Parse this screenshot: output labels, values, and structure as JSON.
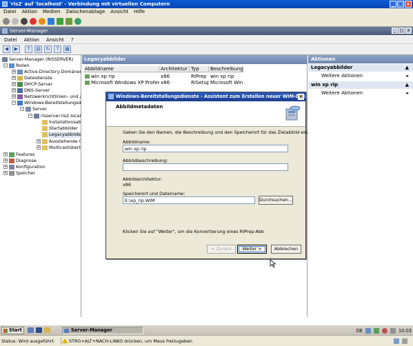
{
  "vm_window": {
    "title": "'ris2' auf 'localhost' - Verbindung mit virtuellen Computern",
    "menu": [
      "Datei",
      "Aktion",
      "Medien",
      "Zwischenablage",
      "Ansicht",
      "Hilfe"
    ]
  },
  "server_manager": {
    "title": "Server-Manager",
    "menu": [
      "Datei",
      "Aktion",
      "Ansicht",
      "?"
    ]
  },
  "tree": {
    "root": "Server-Manager (RISSERVER)",
    "rollen": "Rollen",
    "ad": "Active Directory-Domänend",
    "dateidienste": "Dateidienste",
    "dhcp": "DHCP-Server",
    "dns": "DNS-Server",
    "netzwerk": "Netzwerkrichtlinien- und Zu",
    "wds": "Windows-Bereitstellungsdie",
    "server": "Server",
    "risserver": "risserver.ris2.local",
    "install": "Installationsabb",
    "start": "Startabbilder",
    "legacy": "Legacyabbilder",
    "ausstehend": "Ausstehende G",
    "multicast": "Multicastübertr.",
    "features": "Features",
    "diagnose": "Diagnose",
    "konfiguration": "Konfiguration",
    "speicher": "Speicher"
  },
  "center": {
    "header": "Legacyabbilder",
    "columns": [
      "Abbildname",
      "Architektur",
      "Typ",
      "Beschreibung"
    ],
    "rows": [
      [
        "win xp rip",
        "x86",
        "RIPrep",
        "win xp rip"
      ],
      [
        "Microsoft Windows XP Professional",
        "x86",
        "RISetup",
        "Microsoft Win..."
      ]
    ]
  },
  "actions": {
    "header": "Aktionen",
    "section1": "Legacyabbilder",
    "item1": "Weitere Aktionen",
    "section2": "win xp rip",
    "item2": "Weitere Aktionen"
  },
  "wizard": {
    "title": "Windows-Bereitstellungsdienste - Assistent zum Erstellen neuer WIM-Dateien",
    "banner": "Abbildmetadaten",
    "intro": "Geben Sie den Namen, die Beschreibung und den Speicherort für das Zielabbild ein.",
    "name_label": "Abbildname:",
    "name_value": "win xp rip",
    "desc_label": "Abbildbeschreibung:",
    "desc_value": "",
    "arch_label": "Abbildarchitektur:",
    "arch_value": "x86",
    "path_label": "Speicherort und Dateiname:",
    "path_value": "E:\\xp_rip.WIM",
    "browse": "Durchsuchen...",
    "hint": "Klicken Sie auf \"Weiter\", um die Konvertierung eines RIPrep-Abb",
    "back": "< Zurück",
    "next": "Weiter >",
    "cancel": "Abbrechen"
  },
  "taskbar": {
    "start": "Start",
    "task": "Server-Manager",
    "lang": "DE",
    "clock": "10:03"
  },
  "status": {
    "left": "Status: Wird ausgeführt",
    "right": "STRG+ALT+NACH-LINKS drücken, um Maus freizugeben"
  },
  "colors": {
    "vm_title": "#0a5bd8",
    "header_bar": "#7b90b8",
    "wizard_title": "#2a5cbf",
    "selected": "#dfe6f1"
  }
}
